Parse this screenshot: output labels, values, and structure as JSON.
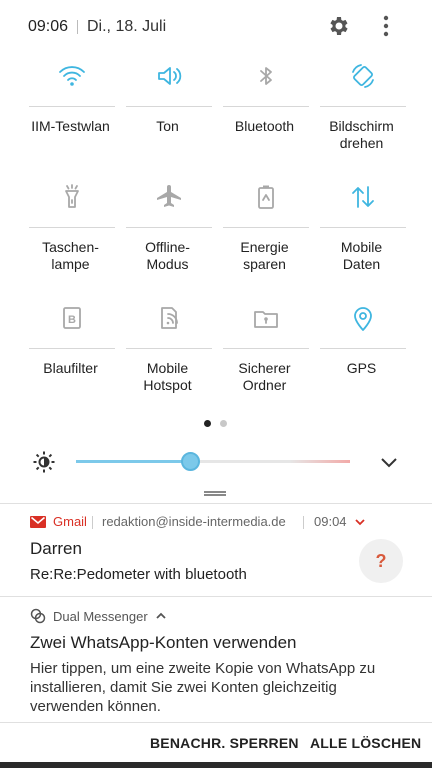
{
  "status": {
    "time": "09:06",
    "date": "Di., 18. Juli"
  },
  "tiles": [
    {
      "label": "IIM-Testwlan",
      "icon": "wifi-icon",
      "active": true
    },
    {
      "label": "Ton",
      "icon": "volume-icon",
      "active": true
    },
    {
      "label": "Bluetooth",
      "icon": "bluetooth-icon",
      "active": false
    },
    {
      "label": "Bildschirm\ndrehen",
      "icon": "rotate-icon",
      "active": true
    },
    {
      "label": "Taschen-\nlampe",
      "icon": "flashlight-icon",
      "active": false
    },
    {
      "label": "Offline-\nModus",
      "icon": "airplane-icon",
      "active": false
    },
    {
      "label": "Energie\nsparen",
      "icon": "battery-icon",
      "active": false
    },
    {
      "label": "Mobile\nDaten",
      "icon": "mobile-data-icon",
      "active": true
    },
    {
      "label": "Blaufilter",
      "icon": "blue-filter-icon",
      "active": false
    },
    {
      "label": "Mobile\nHotspot",
      "icon": "hotspot-icon",
      "active": false
    },
    {
      "label": "Sicherer\nOrdner",
      "icon": "secure-folder-icon",
      "active": false
    },
    {
      "label": "GPS",
      "icon": "gps-icon",
      "active": true
    }
  ],
  "pager": {
    "pages": 2,
    "current": 1
  },
  "brightness": {
    "level": 0.42
  },
  "notifications": {
    "gmail": {
      "app": "Gmail",
      "account": "redaktion@inside-intermedia.de",
      "time": "09:04",
      "title": "Darren",
      "text": "Re:Re:Pedometer with bluetooth",
      "avatar": "?"
    },
    "dual": {
      "app": "Dual Messenger",
      "title": "Zwei WhatsApp-Konten verwenden",
      "text": "Hier tippen, um eine zweite Kopie von WhatsApp zu installieren, damit Sie zwei Konten gleichzeitig verwenden können."
    }
  },
  "actions": {
    "block": "BENACHR. SPERREN",
    "clear": "ALLE LÖSCHEN"
  },
  "colors": {
    "active": "#3fb6e0",
    "inactive": "#a8a8a8",
    "gmail": "#d93025",
    "avatar_q": "#d85a3c"
  }
}
